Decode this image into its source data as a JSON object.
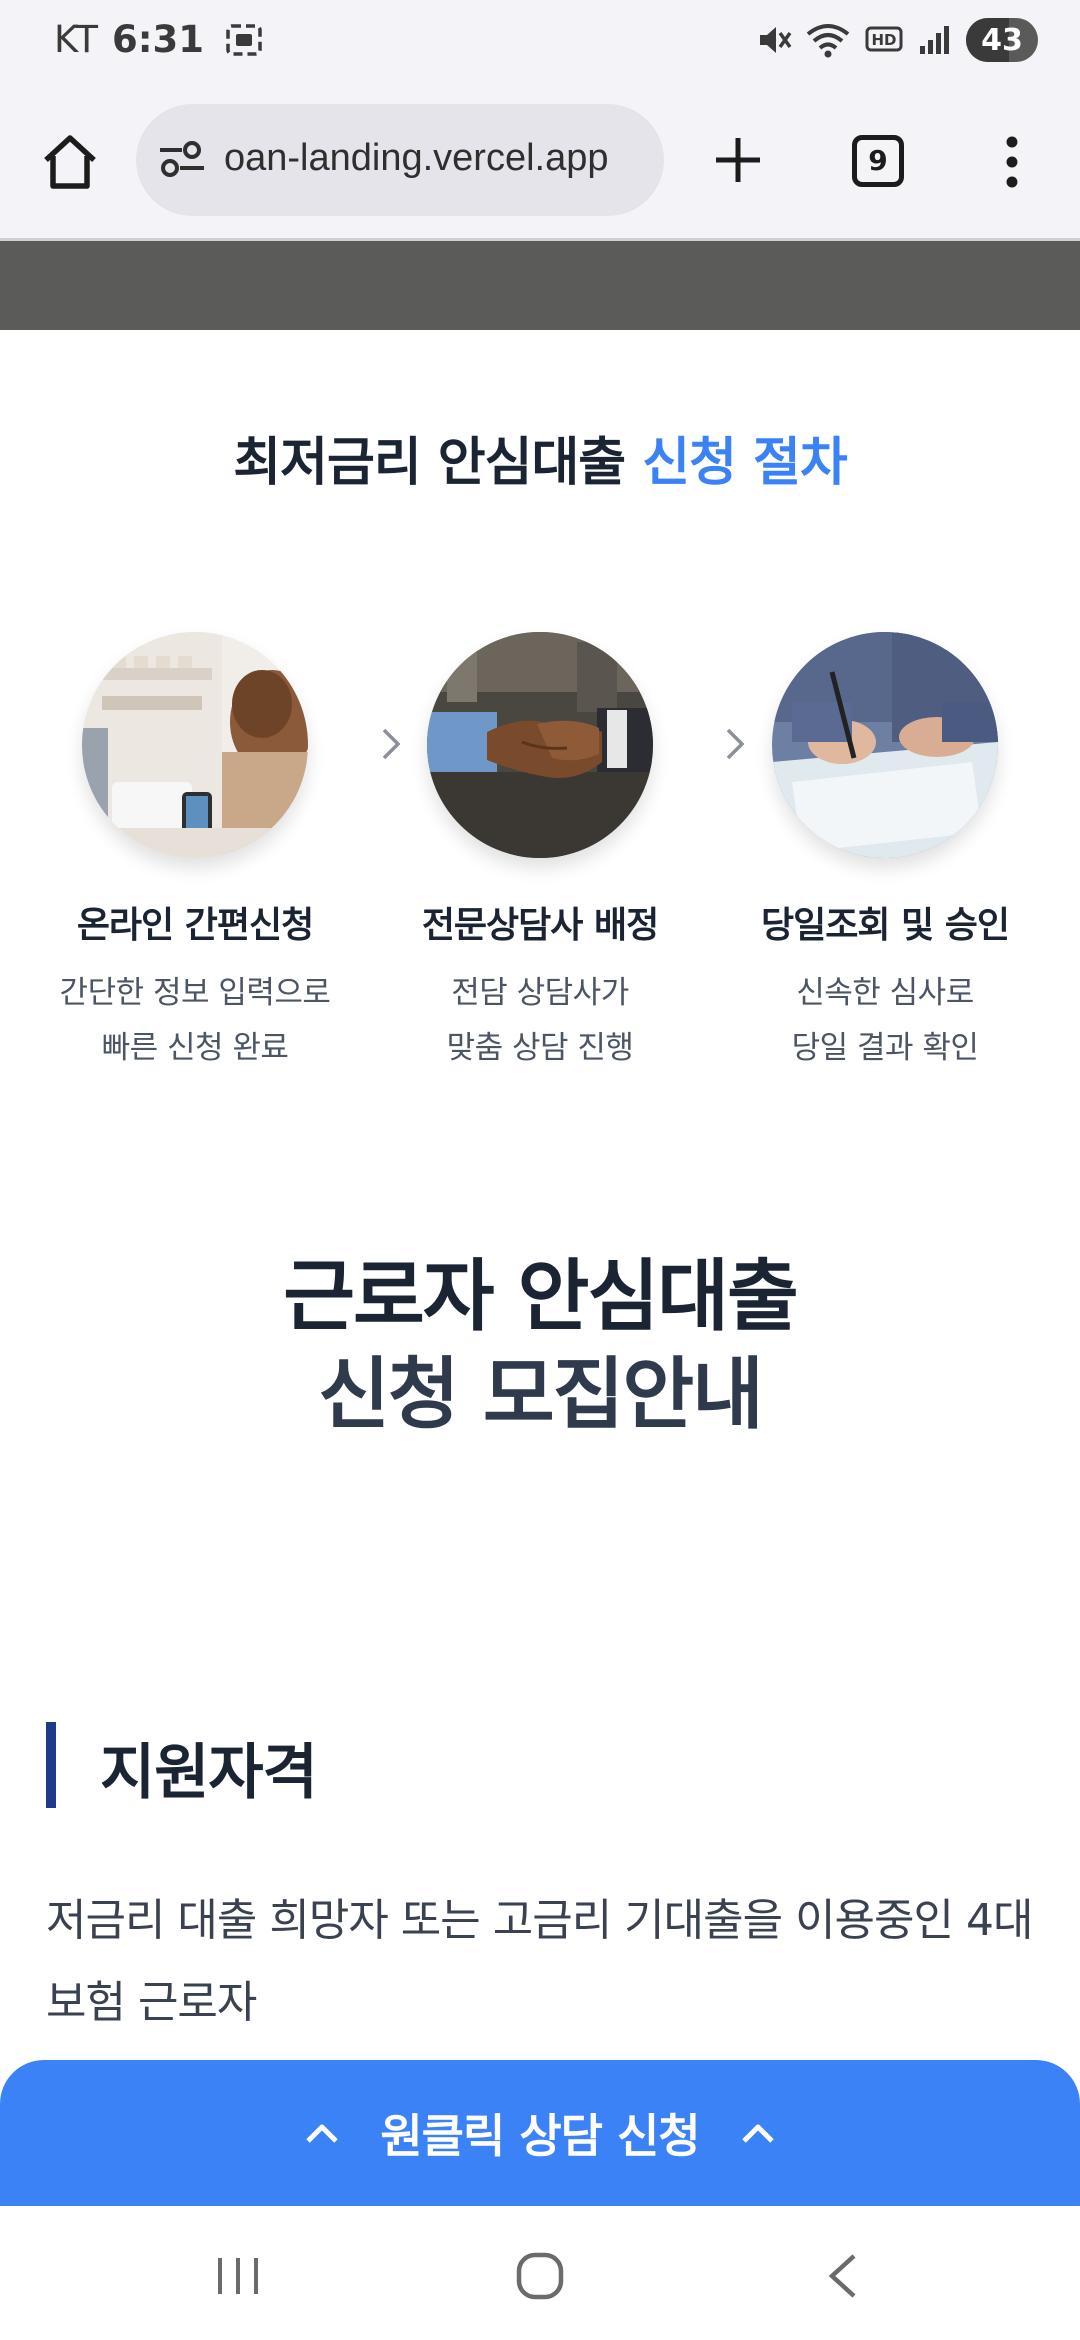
{
  "status_bar": {
    "carrier": "KT",
    "time": "6:31",
    "battery": "43"
  },
  "browser": {
    "url": "oan-landing.vercel.app",
    "tab_count": "9"
  },
  "process": {
    "title_main": "최저금리 안심대출",
    "title_accent": "신청 절차",
    "steps": [
      {
        "title": "온라인 간편신청",
        "desc_line1": "간단한 정보 입력으로",
        "desc_line2": "빠른 신청 완료"
      },
      {
        "title": "전문상담사 배정",
        "desc_line1": "전담 상담사가",
        "desc_line2": "맞춤 상담 진행"
      },
      {
        "title": "당일조회 및 승인",
        "desc_line1": "신속한 심사로",
        "desc_line2": "당일 결과 확인"
      }
    ]
  },
  "recruit": {
    "title_line1": "근로자 안심대출",
    "title_line2": "신청 모집안내"
  },
  "eligibility": {
    "heading": "지원자격",
    "body": "저금리 대출 희망자 또는 고금리 기대출을 이용중인 4대보험 근로자"
  },
  "cta": {
    "label": "원클릭 상담 신청"
  },
  "colors": {
    "accent": "#3b82f6",
    "navy": "#1e3a8a",
    "text": "#1b2433"
  },
  "icons": {
    "home": "home-icon",
    "site_settings": "site-settings-icon",
    "new_tab": "plus-icon",
    "menu": "more-vertical-icon",
    "step_arrow": "chevron-right-icon",
    "cta": "chevron-up-icon"
  }
}
